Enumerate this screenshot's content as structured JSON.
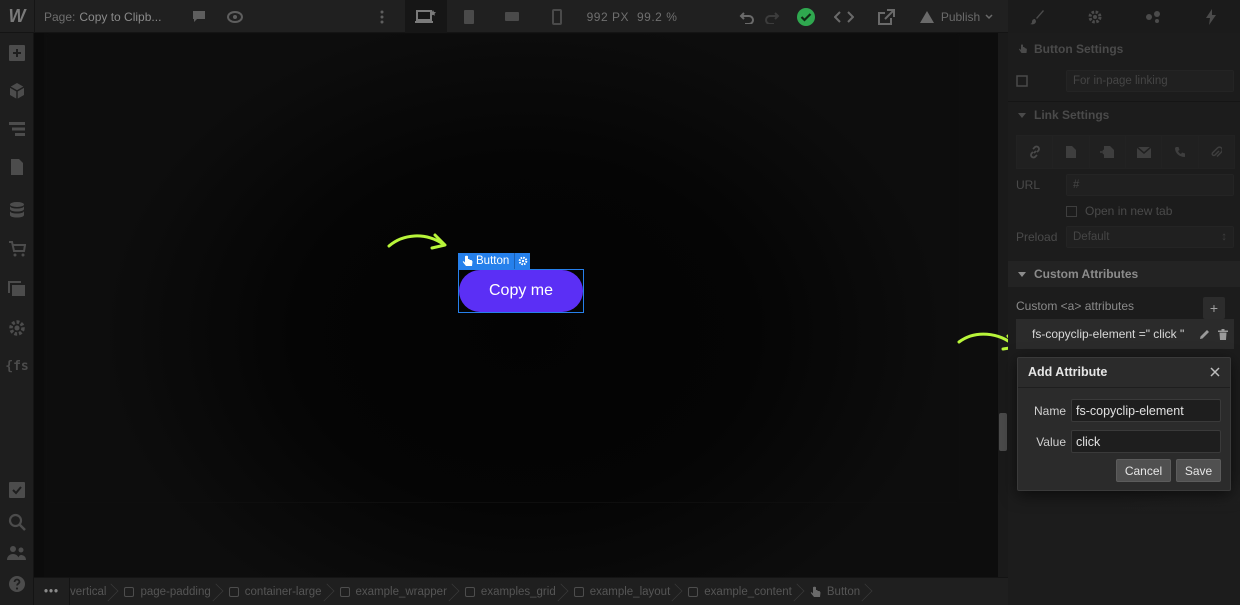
{
  "topbar": {
    "logo": "W",
    "page_prefix": "Page:",
    "page_name": "Copy to Clipb...",
    "width": "992 PX",
    "zoom": "99.2 %",
    "publish": "Publish"
  },
  "canvas": {
    "element_tag": "Button",
    "button_label": "Copy me",
    "accent_color": "#5b2ff5",
    "selection_color": "#2680eb",
    "arrow_color": "#b8f53a"
  },
  "breadcrumb": {
    "more": "•••",
    "items": [
      "vertical",
      "page-padding",
      "container-large",
      "example_wrapper",
      "examples_grid",
      "example_layout",
      "example_content",
      "Button"
    ]
  },
  "panel": {
    "button_settings": "Button Settings",
    "id_placeholder": "For in-page linking",
    "link_settings": "Link Settings",
    "url_label": "URL",
    "url_value": "#",
    "new_tab": "Open in new tab",
    "preload_label": "Preload",
    "preload_value": "Default",
    "custom_attributes": "Custom Attributes",
    "custom_sub": "Custom <a> attributes",
    "attribute_item": "fs-copyclip-element =\" click \""
  },
  "dialog": {
    "title": "Add Attribute",
    "name_label": "Name",
    "name_value": "fs-copyclip-element",
    "value_label": "Value",
    "value_value": "click",
    "cancel": "Cancel",
    "save": "Save"
  }
}
